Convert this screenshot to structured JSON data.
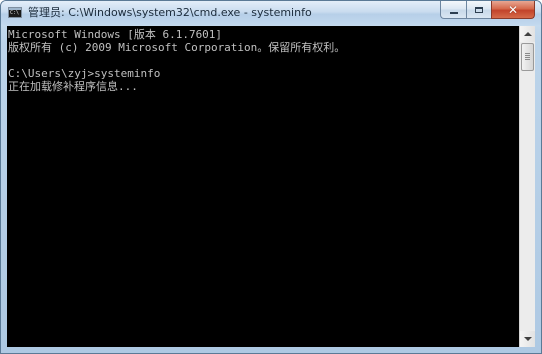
{
  "window": {
    "title": "管理员: C:\\Windows\\system32\\cmd.exe - systeminfo",
    "app_icon": "cmd-icon",
    "controls": {
      "minimize_icon": "minimize-icon",
      "maximize_icon": "maximize-icon",
      "close_icon": "close-icon",
      "close_glyph": "✕"
    }
  },
  "console": {
    "lines": [
      "Microsoft Windows [版本 6.1.7601]",
      "版权所有 (c) 2009 Microsoft Corporation。保留所有权利。",
      "",
      "C:\\Users\\zyj>systeminfo",
      "正在加载修补程序信息..."
    ],
    "background_color": "#000000",
    "text_color": "#c0c0c0"
  },
  "scrollbar": {
    "up_icon": "scroll-up-arrow-icon",
    "down_icon": "scroll-down-arrow-icon"
  },
  "colors": {
    "titlebar": "#c9dcef",
    "close_button": "#c2432a"
  }
}
